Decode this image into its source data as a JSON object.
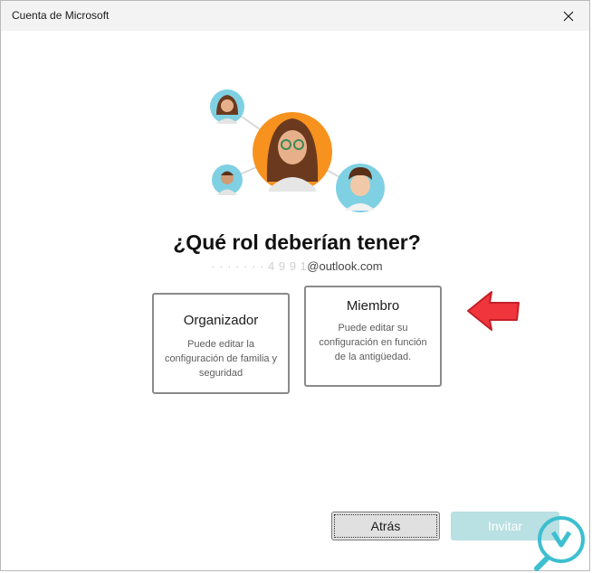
{
  "window": {
    "title": "Cuenta de Microsoft"
  },
  "page": {
    "heading": "¿Qué rol deberían tener?",
    "email_obscured": "·  ·   · ·  · · ·  4 9 9 1",
    "email_visible": "@outlook.com"
  },
  "roles": [
    {
      "title": "Organizador",
      "description": "Puede editar la configuración de familia y seguridad"
    },
    {
      "title": "Miembro",
      "description": "Puede editar su configuración en función de la antigüedad."
    }
  ],
  "buttons": {
    "back": "Atrás",
    "invite": "Invitar"
  },
  "colors": {
    "accent_cyan": "#7fd0e3",
    "orange": "#f7921e",
    "arrow_red": "#f0353d",
    "watermark": "#3dbfd0"
  },
  "icons": [
    "close-icon",
    "family-illustration",
    "red-arrow",
    "watermark-logo"
  ]
}
